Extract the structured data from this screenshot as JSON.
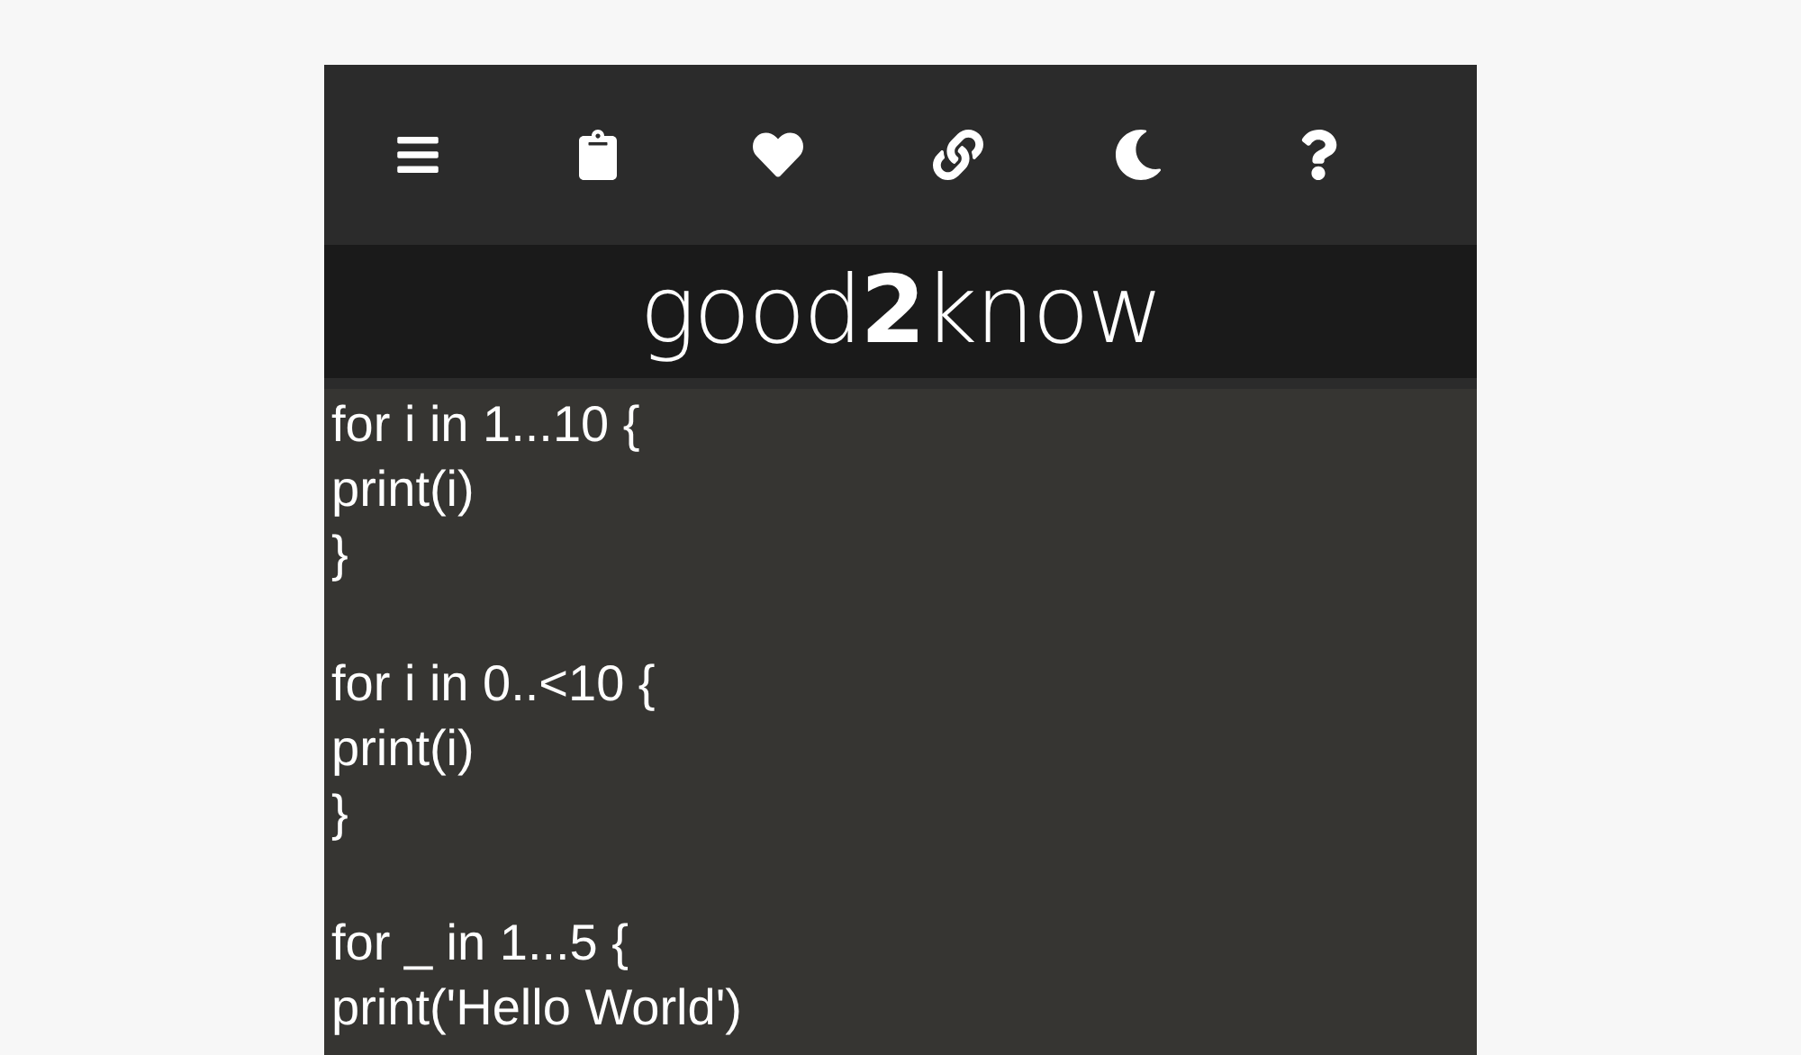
{
  "title": "good**2**know",
  "code_blocks": [
    {
      "lines": [
        "for i in 1...10 {",
        "print(i)",
        "}"
      ]
    },
    {
      "lines": [
        "for i in 0..<10 {",
        "print(i)",
        "}"
      ]
    },
    {
      "lines": [
        "for _ in 1...5 {",
        "print('Hello World')"
      ]
    }
  ]
}
